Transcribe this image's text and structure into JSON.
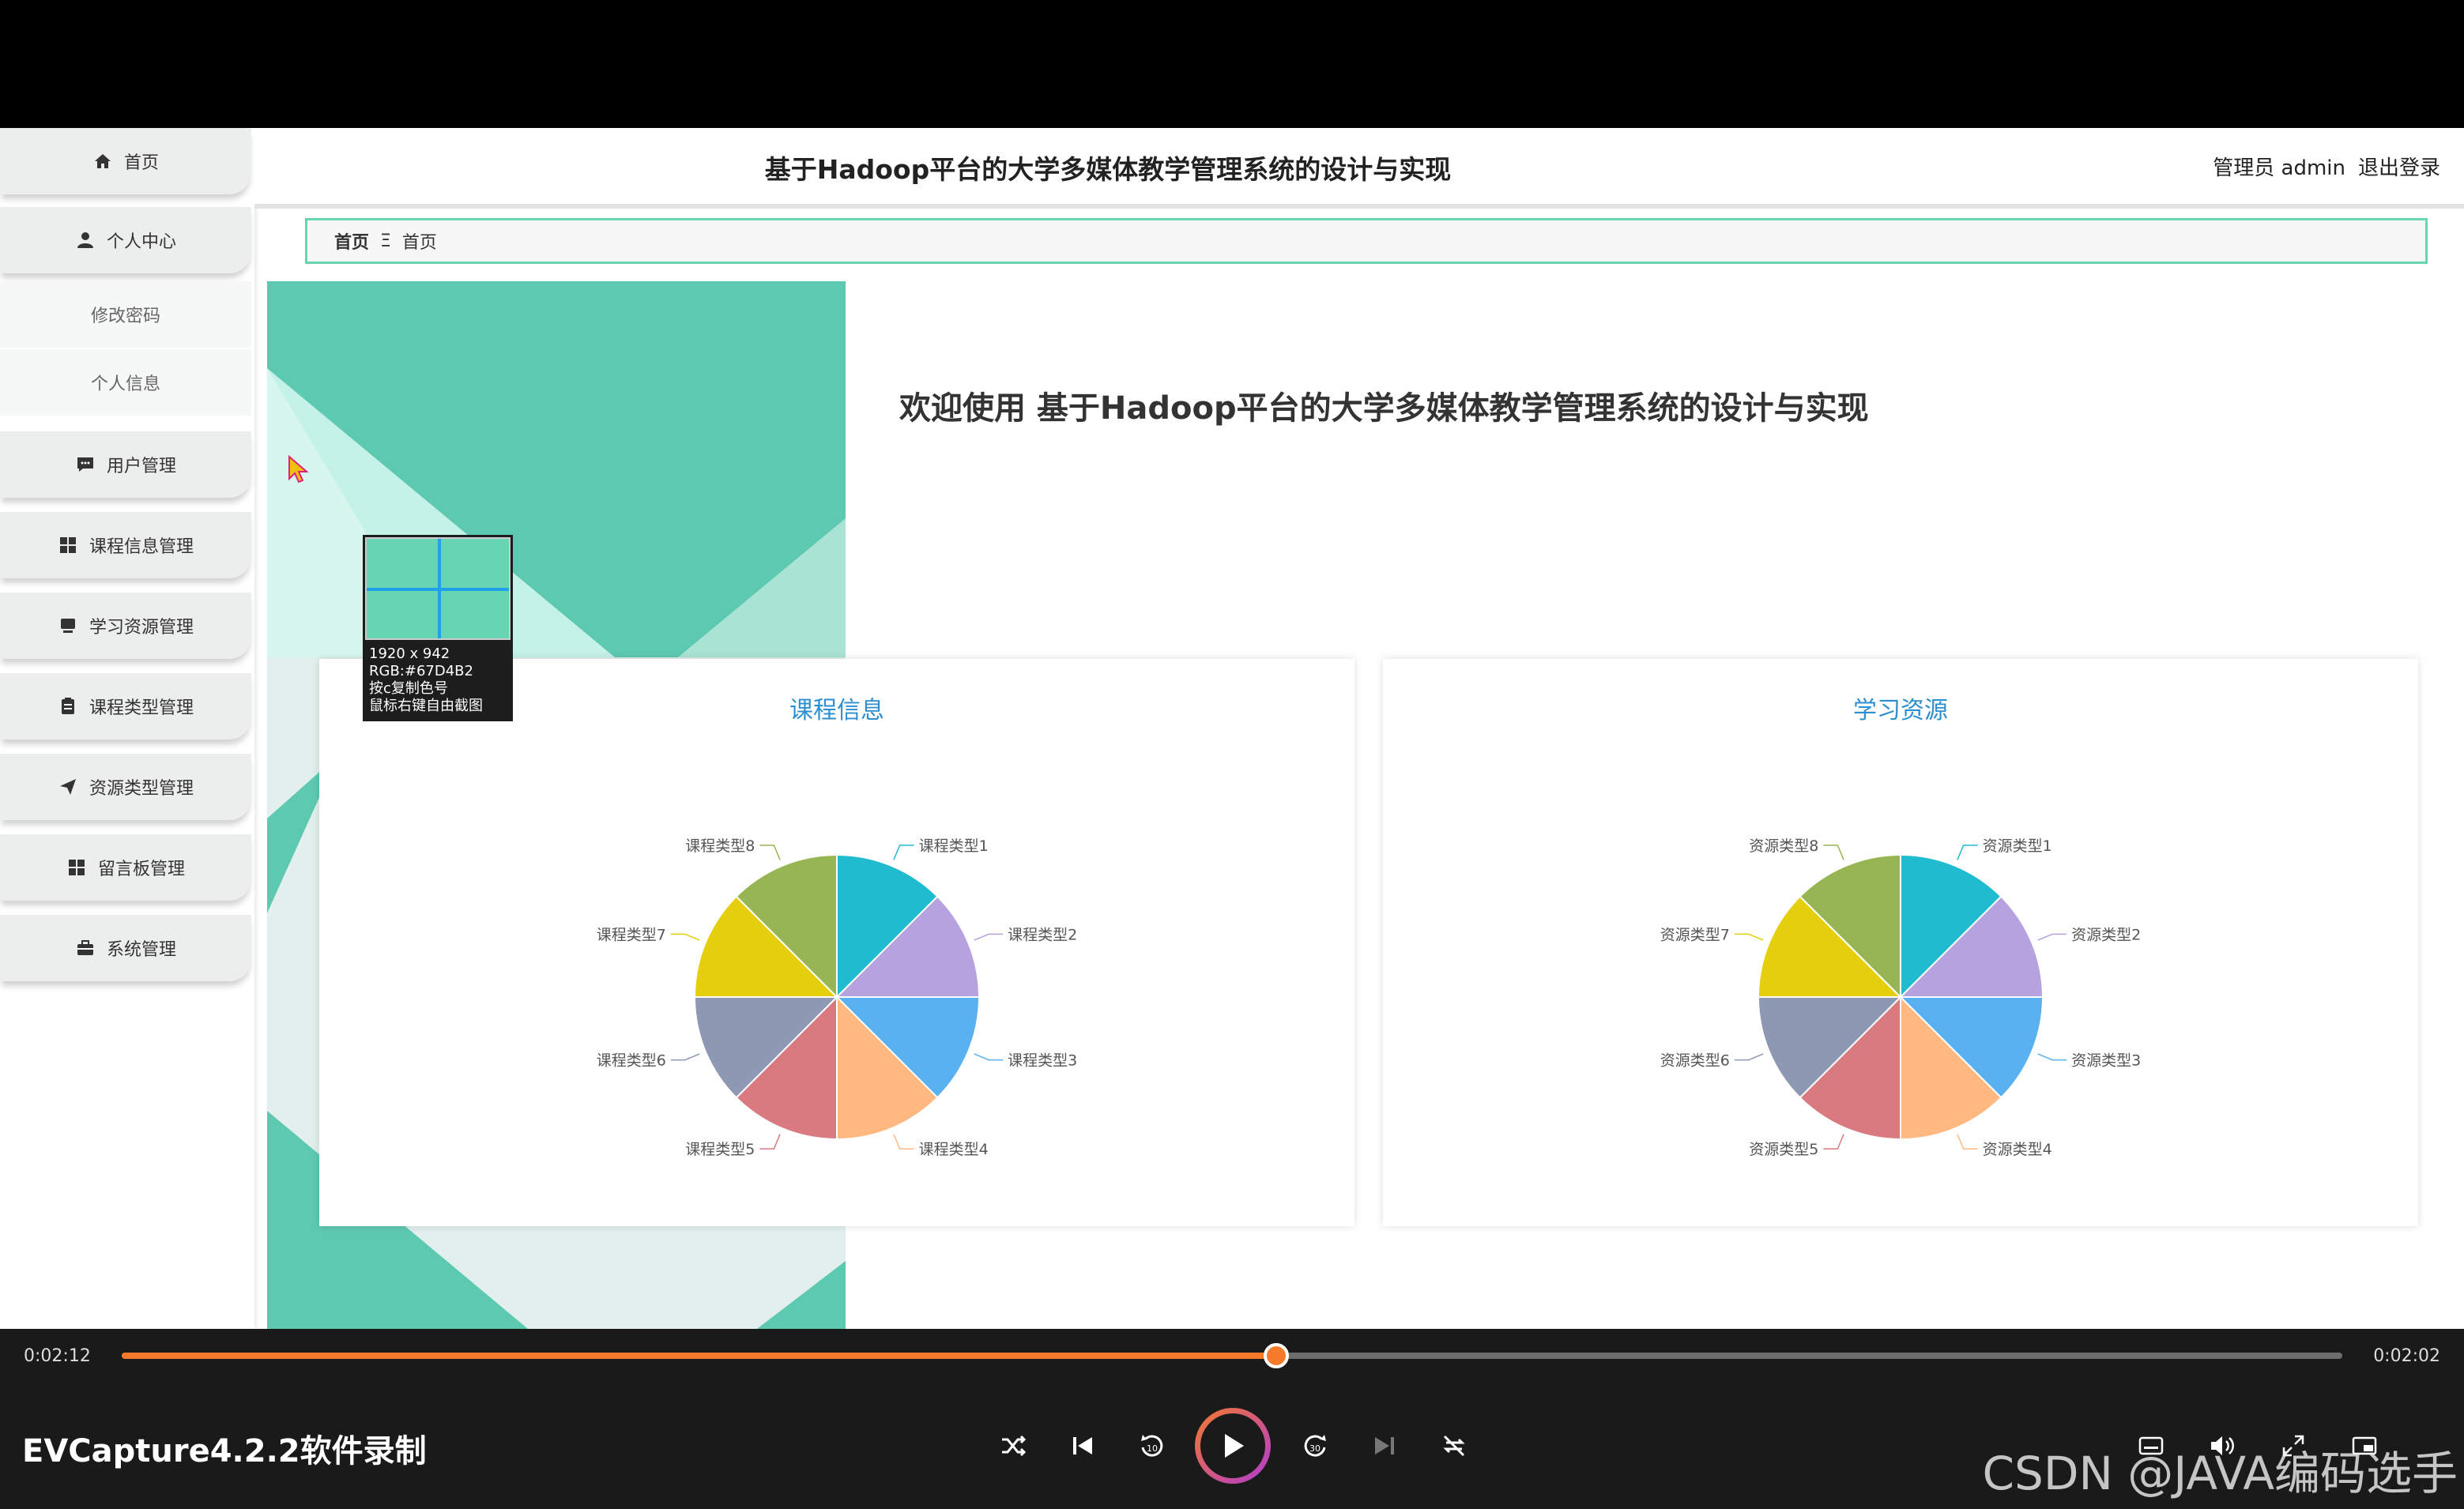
{
  "app": {
    "title": "基于Hadoop平台的大学多媒体教学管理系统的设计与实现",
    "user_role": "管理员",
    "user_name": "admin",
    "logout": "退出登录"
  },
  "sidebar": {
    "items": [
      {
        "label": "首页",
        "icon": "home-icon"
      },
      {
        "label": "个人中心",
        "icon": "user-icon"
      },
      {
        "label": "修改密码",
        "sub": true
      },
      {
        "label": "个人信息",
        "sub": true
      },
      {
        "label": "用户管理",
        "icon": "chat-icon"
      },
      {
        "label": "课程信息管理",
        "icon": "grid-icon"
      },
      {
        "label": "学习资源管理",
        "icon": "monitor-icon"
      },
      {
        "label": "课程类型管理",
        "icon": "clipboard-icon"
      },
      {
        "label": "资源类型管理",
        "icon": "send-icon"
      },
      {
        "label": "留言板管理",
        "icon": "grid-icon"
      },
      {
        "label": "系统管理",
        "icon": "briefcase-icon"
      }
    ]
  },
  "breadcrumb": {
    "home": "首页",
    "separator": "Ξ",
    "current": "首页"
  },
  "welcome": "欢迎使用 基于Hadoop平台的大学多媒体教学管理系统的设计与实现",
  "colors": {
    "accent": "#67d4b2",
    "slices": [
      "#21bbcf",
      "#b6a2de",
      "#5ab1ef",
      "#ffb980",
      "#d87a80",
      "#8d98b3",
      "#e5cf0d",
      "#97b552"
    ]
  },
  "chart_data": [
    {
      "type": "pie",
      "title": "课程信息",
      "categories": [
        "课程类型1",
        "课程类型2",
        "课程类型3",
        "课程类型4",
        "课程类型5",
        "课程类型6",
        "课程类型7",
        "课程类型8"
      ],
      "values": [
        1,
        1,
        1,
        1,
        1,
        1,
        1,
        1
      ]
    },
    {
      "type": "pie",
      "title": "学习资源",
      "categories": [
        "资源类型1",
        "资源类型2",
        "资源类型3",
        "资源类型4",
        "资源类型5",
        "资源类型6",
        "资源类型7",
        "资源类型8"
      ],
      "values": [
        1,
        1,
        1,
        1,
        1,
        1,
        1,
        1
      ]
    }
  ],
  "color_picker": {
    "lines": [
      "1920 x 942",
      "RGB:#67D4B2",
      "按c复制色号",
      "鼠标右键自由截图"
    ]
  },
  "player": {
    "current_time": "0:02:12",
    "total_time": "0:02:02",
    "progress": 0.52,
    "app_label": "EVCapture4.2.2软件录制",
    "watermark": "CSDN @JAVA编码选手"
  }
}
